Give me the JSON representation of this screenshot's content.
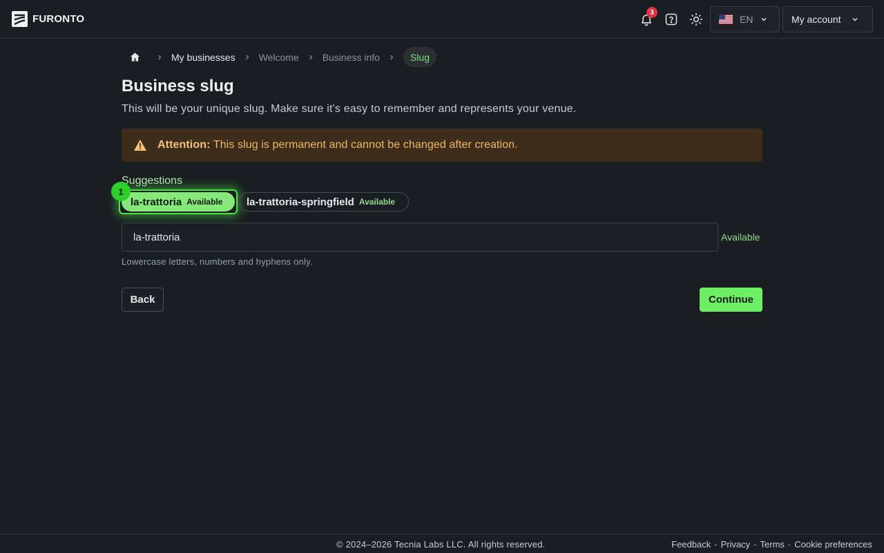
{
  "header": {
    "logo_text": "FURONTO",
    "notifications_count": "3",
    "language_label": "EN",
    "account_label": "My account"
  },
  "breadcrumb": {
    "items": [
      "My businesses",
      "Welcome",
      "Business info"
    ],
    "current": "Slug"
  },
  "page": {
    "title": "Business slug",
    "subtitle": "This will be your unique slug. Make sure it's easy to remember and represents your venue."
  },
  "alert": {
    "strong": "Attention:",
    "text": " This slug is permanent and cannot be changed after creation."
  },
  "suggestions": {
    "label": "Suggestions",
    "marker": "1",
    "items": [
      {
        "name": "la-trattoria",
        "status": "Available"
      },
      {
        "name": "la-trattoria-springfield",
        "status": "Available"
      }
    ]
  },
  "slug_field": {
    "value": "la-trattoria",
    "status": "Available",
    "hint": "Lowercase letters, numbers and hyphens only."
  },
  "actions": {
    "back": "Back",
    "continue": "Continue"
  },
  "footer": {
    "copyright": "© 2024–2026 Tecnia Labs LLC. All rights reserved.",
    "links": [
      "Feedback",
      "Privacy",
      "Terms",
      "Cookie preferences"
    ],
    "separator": "-"
  },
  "colors": {
    "accent": "#6ef064",
    "background": "#1a1d21",
    "warning_bg": "#3d2d1a",
    "warning_text": "#f0b969",
    "badge": "#d9363e"
  },
  "icons": {
    "notifications": "bell-icon",
    "help": "question-icon",
    "theme": "sun-icon",
    "language_flag": "us-flag-icon",
    "home": "home-icon",
    "warning": "warning-triangle-icon"
  }
}
